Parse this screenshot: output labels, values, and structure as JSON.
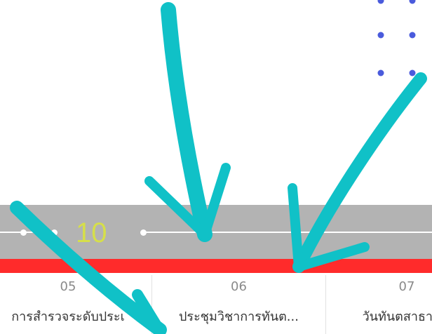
{
  "colors": {
    "timeline_bar": "#b3b3b3",
    "accent_red": "#ff2b2b",
    "current_number": "#d6df4a",
    "annotation_arrow": "#10c1c7",
    "dots": "#4a5bdc"
  },
  "timeline": {
    "current_label": "10"
  },
  "events": [
    {
      "number": "05",
      "title": "การสำรวจระดับประเ"
    },
    {
      "number": "06",
      "title": "ประชุมวิชาการทันต..."
    },
    {
      "number": "07",
      "title": "วันทันตสาธารณ"
    }
  ]
}
